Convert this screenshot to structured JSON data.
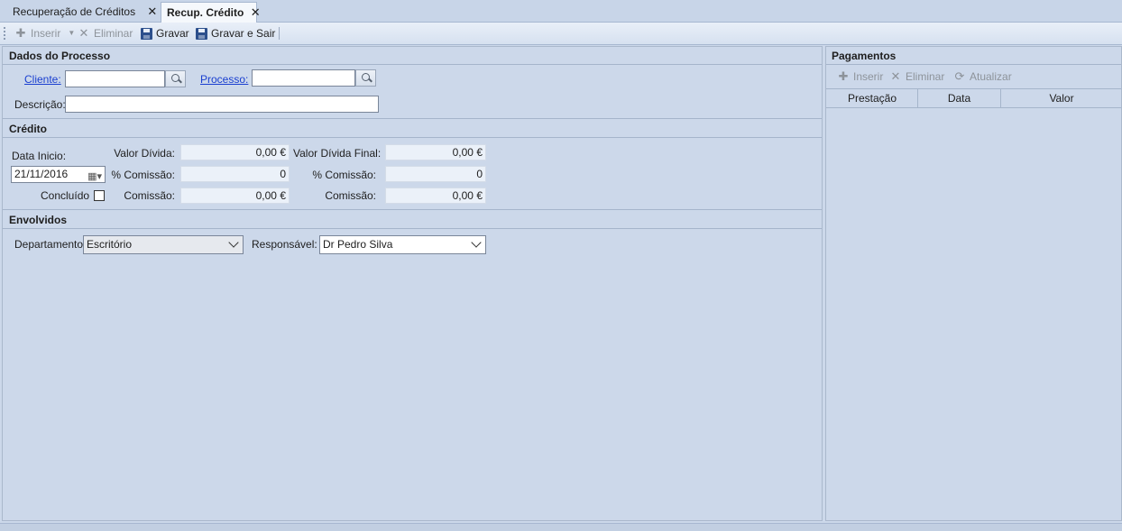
{
  "tabs": [
    {
      "label": "Recuperação de Créditos",
      "close": "✕"
    },
    {
      "label": "Recup. Crédito",
      "close": "✕"
    }
  ],
  "toolbar": {
    "inserir": "Inserir",
    "eliminar": "Eliminar",
    "gravar": "Gravar",
    "gravar_sair": "Gravar e Sair"
  },
  "dados_processo": {
    "title": "Dados do Processo",
    "cliente_label": "Cliente:",
    "cliente_value": "",
    "processo_label": "Processo:",
    "processo_value": "",
    "descricao_label": "Descrição:",
    "descricao_value": ""
  },
  "credito": {
    "title": "Crédito",
    "data_inicio_label": "Data Inicio:",
    "data_inicio_value": "21/11/2016",
    "concluido_label": "Concluído",
    "concluido_checked": false,
    "valor_divida_label": "Valor Dívida:",
    "valor_divida_value": "0,00 €",
    "comissao_pct_label": "% Comissão:",
    "comissao_pct_value": "0",
    "comissao_label": "Comissão:",
    "comissao_value": "0,00 €",
    "valor_divida_final_label": "Valor Dívida Final:",
    "valor_divida_final_value": "0,00 €",
    "comissao_pct2_label": "% Comissão:",
    "comissao_pct2_value": "0",
    "comissao2_label": "Comissão:",
    "comissao2_value": "0,00 €"
  },
  "envolvidos": {
    "title": "Envolvidos",
    "departamento_label": "Departamento:",
    "departamento_value": "Escritório",
    "responsavel_label": "Responsável:",
    "responsavel_value": "Dr Pedro Silva"
  },
  "pagamentos": {
    "title": "Pagamentos",
    "inserir": "Inserir",
    "eliminar": "Eliminar",
    "atualizar": "Atualizar",
    "columns": [
      "Prestação",
      "Data",
      "Valor"
    ],
    "rows": []
  },
  "colors": {
    "background": "#ccd8ea",
    "link": "#1a3fd0",
    "field_readonly": "#ebf1f9"
  }
}
